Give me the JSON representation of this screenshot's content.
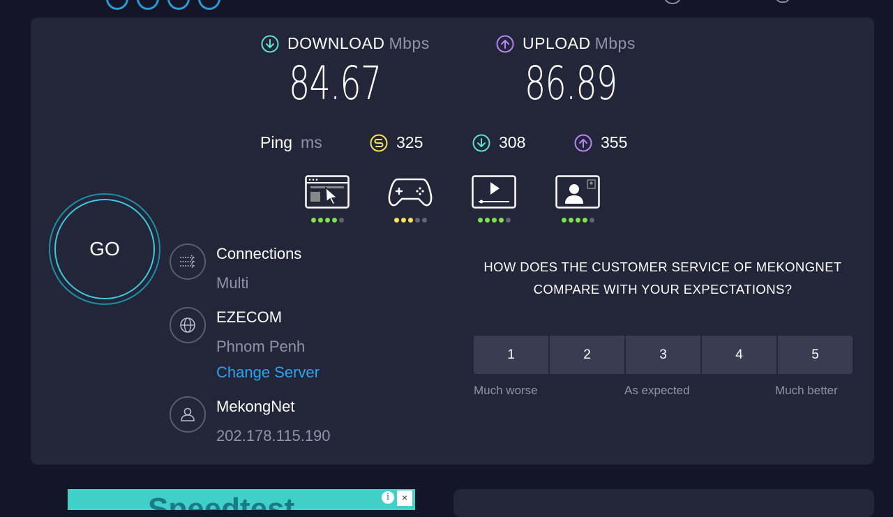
{
  "download": {
    "label": "DOWNLOAD",
    "unit": "Mbps",
    "value": "84.67",
    "icon": "download-arrow-icon"
  },
  "upload": {
    "label": "UPLOAD",
    "unit": "Mbps",
    "value": "86.89",
    "icon": "upload-arrow-icon"
  },
  "ping": {
    "label": "Ping",
    "unit": "ms",
    "idle": "325",
    "download": "308",
    "upload": "355"
  },
  "experience": [
    {
      "name": "web-browsing-icon",
      "rating": 4,
      "color": "#7ee04a"
    },
    {
      "name": "gaming-icon",
      "rating": 3,
      "color": "#f5e15a"
    },
    {
      "name": "video-streaming-icon",
      "rating": 4,
      "color": "#7ee04a"
    },
    {
      "name": "video-call-icon",
      "rating": 4,
      "color": "#7ee04a"
    }
  ],
  "go_label": "GO",
  "connections": {
    "title": "Connections",
    "value": "Multi"
  },
  "server": {
    "title": "EZECOM",
    "location": "Phnom Penh",
    "change": "Change Server"
  },
  "isp": {
    "title": "MekongNet",
    "ip": "202.178.115.190"
  },
  "survey": {
    "question": "HOW DOES THE CUSTOMER SERVICE OF MEKONGNET COMPARE WITH YOUR EXPECTATIONS?",
    "options": [
      "1",
      "2",
      "3",
      "4",
      "5"
    ],
    "low": "Much worse",
    "mid": "As expected",
    "high": "Much better"
  },
  "ad": {
    "text": "Speedtest",
    "info": "i",
    "close": "×"
  },
  "colors": {
    "download": "#5fe0d2",
    "upload": "#b786f5",
    "idle": "#f5e15a",
    "accent": "#2aa4f4"
  }
}
